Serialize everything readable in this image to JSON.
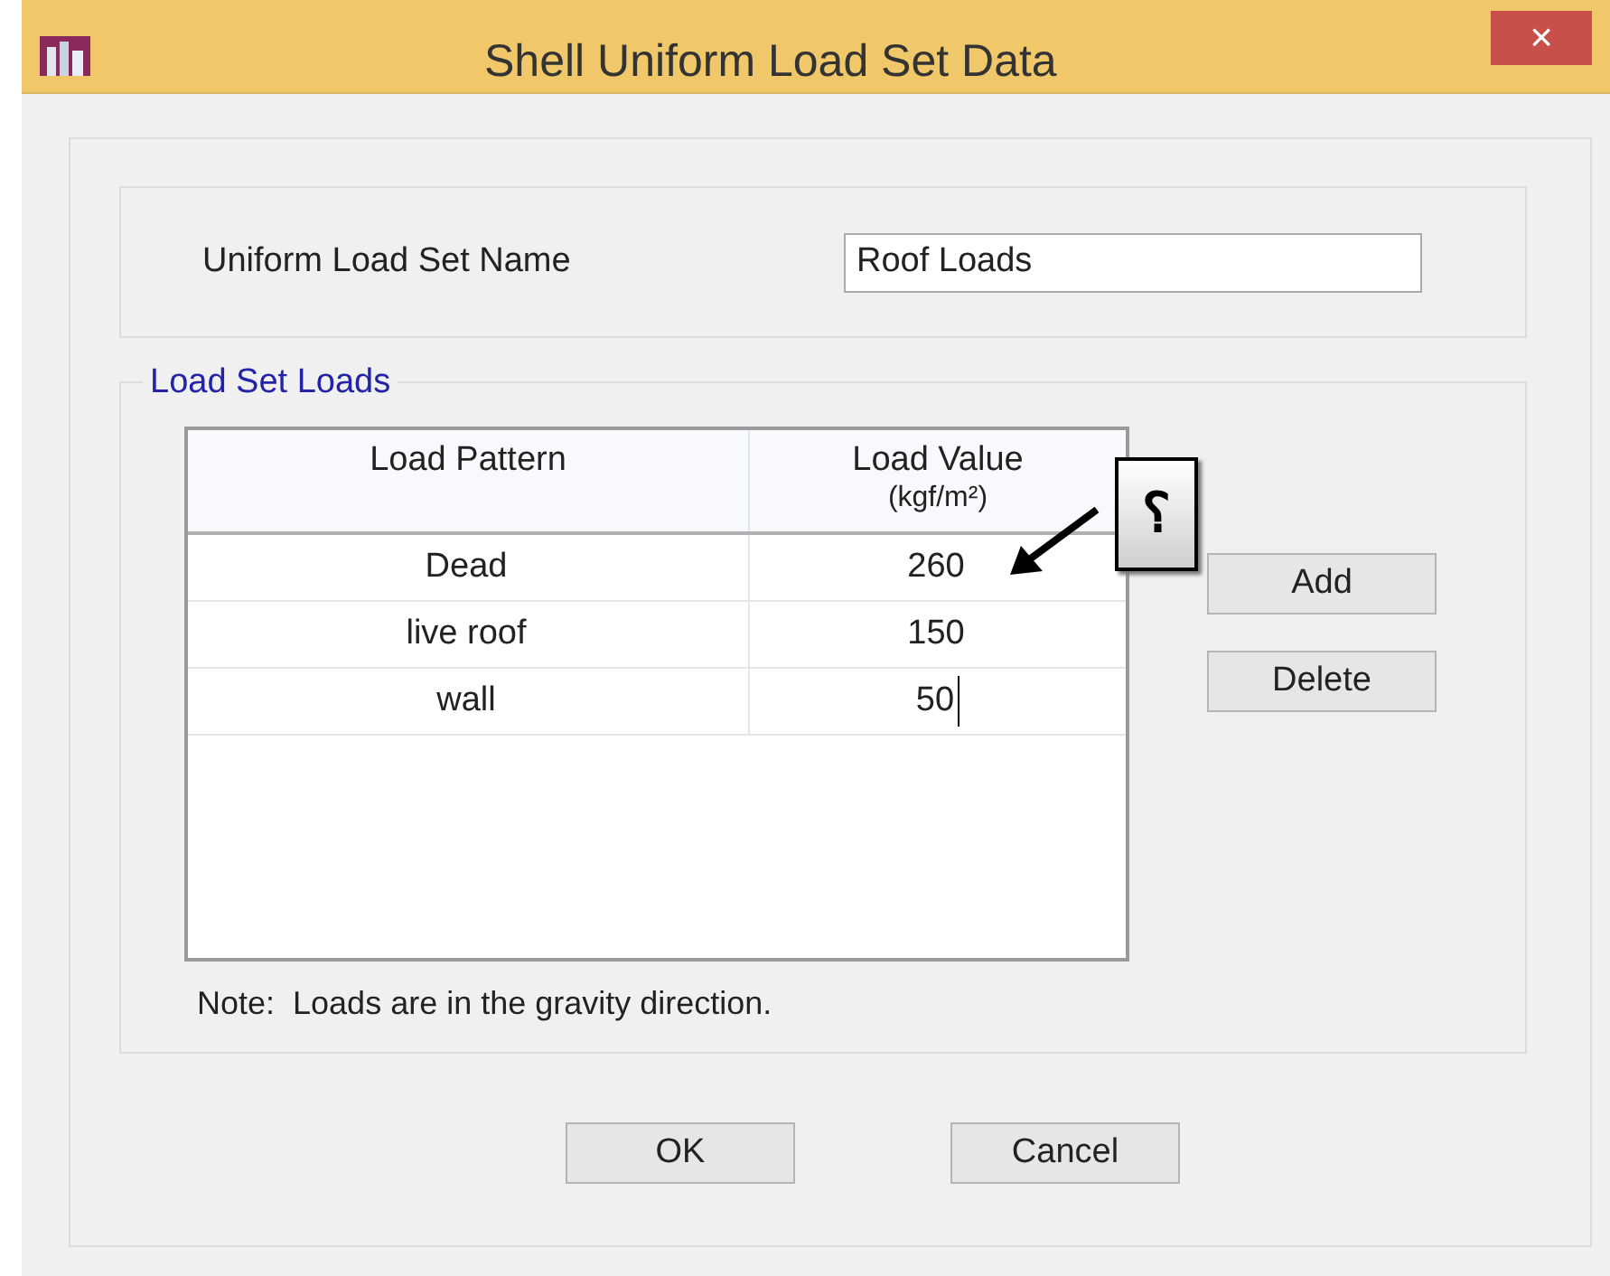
{
  "window": {
    "title": "Shell Uniform Load Set Data",
    "close_glyph": "×"
  },
  "name_field": {
    "label": "Uniform Load Set Name",
    "value": "Roof Loads"
  },
  "load_set": {
    "title": "Load Set Loads",
    "columns": [
      {
        "lines": [
          "Load Pattern"
        ]
      },
      {
        "lines": [
          "Load Value",
          "(kgf/m²)"
        ]
      }
    ],
    "rows": [
      [
        {
          "text": "Dead",
          "editing": false
        },
        {
          "text": "260",
          "editing": false
        }
      ],
      [
        {
          "text": "live roof",
          "editing": false
        },
        {
          "text": "150",
          "editing": false
        }
      ],
      [
        {
          "text": "wall",
          "editing": false
        },
        {
          "text": "50",
          "editing": true
        }
      ]
    ],
    "buttons": [
      "Add",
      "Delete"
    ],
    "note": "Note:  Loads are in the gravity direction."
  },
  "callout": {
    "text": "؟"
  },
  "buttons": [
    "OK",
    "Cancel"
  ]
}
